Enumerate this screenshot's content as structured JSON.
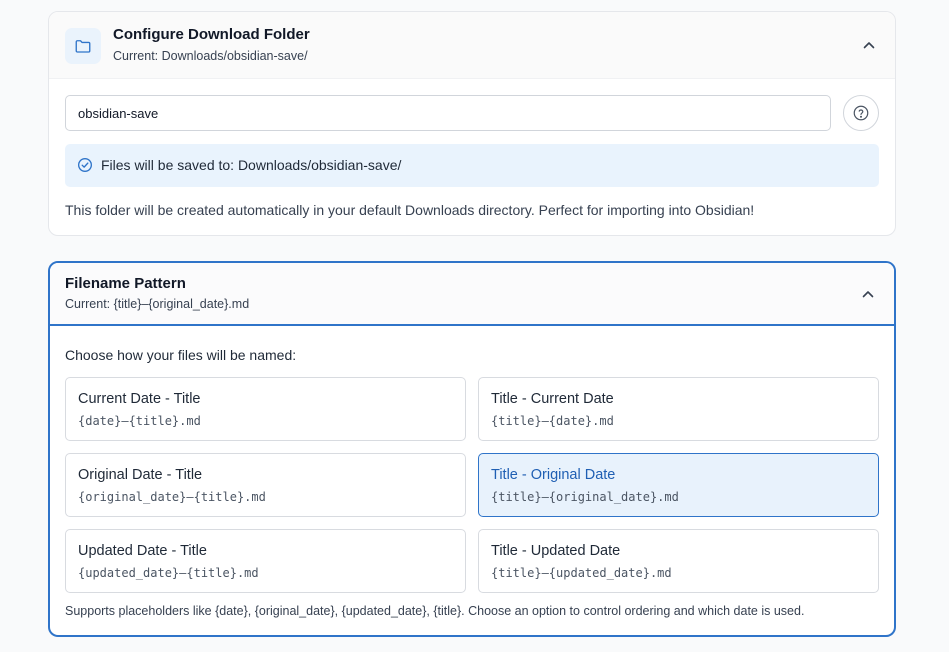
{
  "folder_section": {
    "title": "Configure Download Folder",
    "current": "Current: Downloads/obsidian-save/",
    "input_value": "obsidian-save",
    "info_text": "Files will be saved to: Downloads/obsidian-save/",
    "description": "This folder will be created automatically in your default Downloads directory. Perfect for importing into Obsidian!"
  },
  "pattern_section": {
    "title": "Filename Pattern",
    "current": "Current: {title}–{original_date}.md",
    "choose_label": "Choose how your files will be named:",
    "options": [
      {
        "label": "Current Date - Title",
        "code": "{date}–{title}.md",
        "selected": false
      },
      {
        "label": "Title - Current Date",
        "code": "{title}–{date}.md",
        "selected": false
      },
      {
        "label": "Original Date - Title",
        "code": "{original_date}–{title}.md",
        "selected": false
      },
      {
        "label": "Title - Original Date",
        "code": "{title}–{original_date}.md",
        "selected": true
      },
      {
        "label": "Updated Date - Title",
        "code": "{updated_date}–{title}.md",
        "selected": false
      },
      {
        "label": "Title - Updated Date",
        "code": "{title}–{updated_date}.md",
        "selected": false
      }
    ],
    "footnote": "Supports placeholders like {date}, {original_date}, {updated_date}, {title}. Choose an option to control ordering and which date is used."
  },
  "colors": {
    "accent": "#2f74c9",
    "info_bg": "#e9f3fd",
    "selected_bg": "#e8f2fc"
  },
  "icons": [
    "folder-icon",
    "chevron-up-icon",
    "help-circle-icon",
    "check-circle-icon"
  ]
}
